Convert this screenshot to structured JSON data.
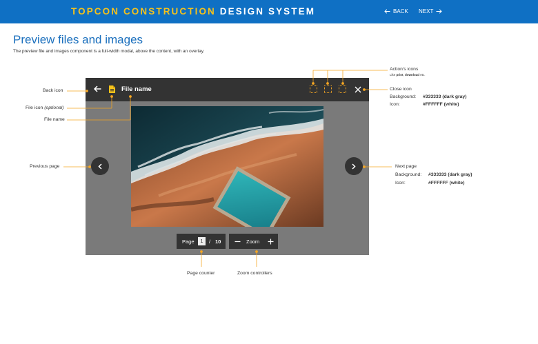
{
  "header": {
    "brand_part1": "TOPCON CONSTRUCTION",
    "brand_part2": "DESIGN SYSTEM",
    "back_label": "BACK",
    "next_label": "NEXT",
    "bg_color": "#0f70c4",
    "accent_color": "#f5c21b"
  },
  "page": {
    "title": "Preview files and images",
    "description": "The preview file and images component is a full-width modal, above the content, with an overlay."
  },
  "modal": {
    "file_name": "File name",
    "back_icon": "arrow-left-icon",
    "file_icon": "document-icon",
    "close_icon": "close-icon",
    "action_icons_count": 3,
    "page_label": "Page",
    "current_page": "1",
    "page_separator": "/",
    "total_pages": "10",
    "zoom_label": "Zoom",
    "zoom_out_icon": "minus-icon",
    "zoom_in_icon": "plus-icon",
    "header_color": "#333333",
    "overlay_color": "#7a7a7a"
  },
  "annotations": {
    "back_icon": "Back icon",
    "file_icon": "File icon ",
    "file_icon_optional": "(optional)",
    "file_name": "File name",
    "previous_page": "Previous page",
    "actions_title": "Action's icons",
    "actions_note_prefix": "Like ",
    "actions_note_print": "print",
    "actions_note_comma": ", ",
    "actions_note_download": "download",
    "actions_note_suffix": " etc.",
    "close_title": "Close icon",
    "close_bg_label": "Background:",
    "close_bg_value": "#333333 (dark gray)",
    "close_icon_label": "Icon:",
    "close_icon_value": "#FFFFFF (white)",
    "next_title": "Next page",
    "next_bg_label": "Background:",
    "next_bg_value": "#333333 (dark gray)",
    "next_icon_label": "Icon:",
    "next_icon_value": "#FFFFFF (white)",
    "page_counter": "Page counter",
    "zoom_controllers": "Zoom controllers",
    "line_color": "#f5a623"
  }
}
